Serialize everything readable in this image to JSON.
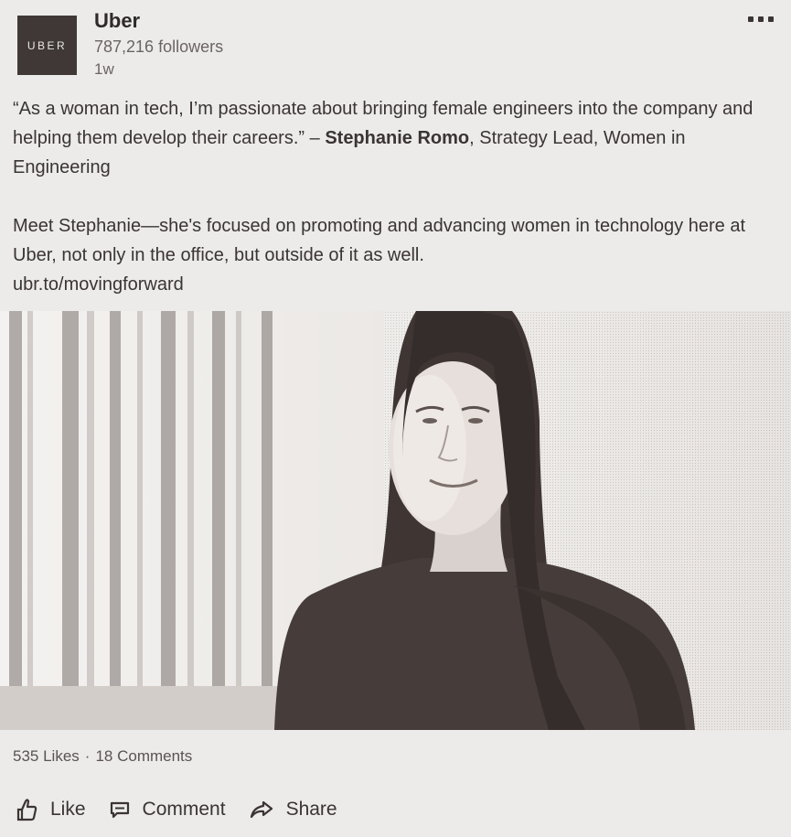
{
  "header": {
    "logo_text": "UBER",
    "company_name": "Uber",
    "followers": "787,216 followers",
    "time": "1w"
  },
  "post": {
    "quote": "“As a woman in tech, I’m passionate about bringing female engineers into the company and helping them develop their careers.” – ",
    "author": "Stephanie Romo",
    "author_title": ", Strategy Lead, Women in Engineering",
    "paragraph": "Meet Stephanie—she's focused on promoting and advancing women in technology here at Uber, not only in the office, but outside of it as well.",
    "link": "ubr.to/movingforward"
  },
  "stats": {
    "likes": "535 Likes",
    "separator": "·",
    "comments": "18 Comments"
  },
  "actions": {
    "like_label": "Like",
    "comment_label": "Comment",
    "share_label": "Share"
  },
  "icons": {
    "more": "more-horizontal-icon",
    "like": "thumbs-up-icon",
    "comment": "comment-icon",
    "share": "share-arrow-icon"
  },
  "colors": {
    "background": "#ecebe9",
    "text": "#3a3433",
    "logo_bg": "#3f3836"
  }
}
